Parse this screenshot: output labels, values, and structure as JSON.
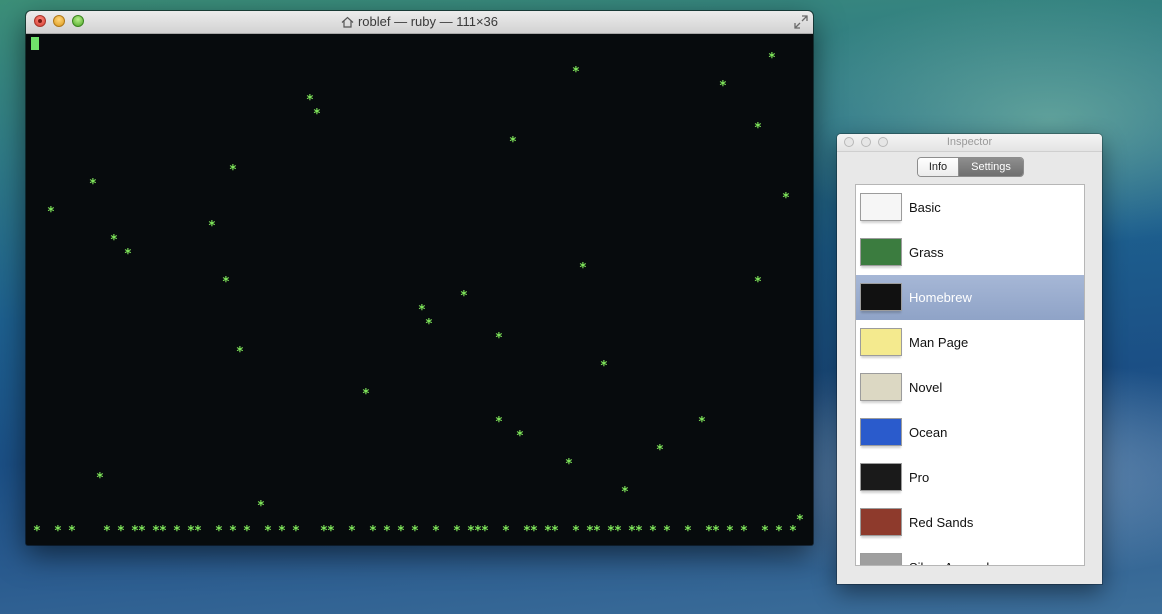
{
  "terminal": {
    "title": "roblef — ruby — 111×36",
    "flake_char": "*",
    "flake_color": "#7fe65a",
    "background": "#070b0d"
  },
  "inspector": {
    "title": "Inspector",
    "tabs": [
      {
        "label": "Info",
        "selected": false
      },
      {
        "label": "Settings",
        "selected": true
      }
    ],
    "profiles": [
      {
        "name": "Basic",
        "swatch": "#f6f6f6",
        "selected": false
      },
      {
        "name": "Grass",
        "swatch": "#3b7c3f",
        "selected": false
      },
      {
        "name": "Homebrew",
        "swatch": "#111111",
        "selected": true
      },
      {
        "name": "Man Page",
        "swatch": "#f4ea8e",
        "selected": false
      },
      {
        "name": "Novel",
        "swatch": "#dcd8c3",
        "selected": false
      },
      {
        "name": "Ocean",
        "swatch": "#2a5bcc",
        "selected": false
      },
      {
        "name": "Pro",
        "swatch": "#1a1a1a",
        "selected": false
      },
      {
        "name": "Red Sands",
        "swatch": "#8e3a2c",
        "selected": false
      },
      {
        "name": "Silver Aerogel",
        "swatch": "#9f9f9f",
        "selected": false
      }
    ]
  }
}
